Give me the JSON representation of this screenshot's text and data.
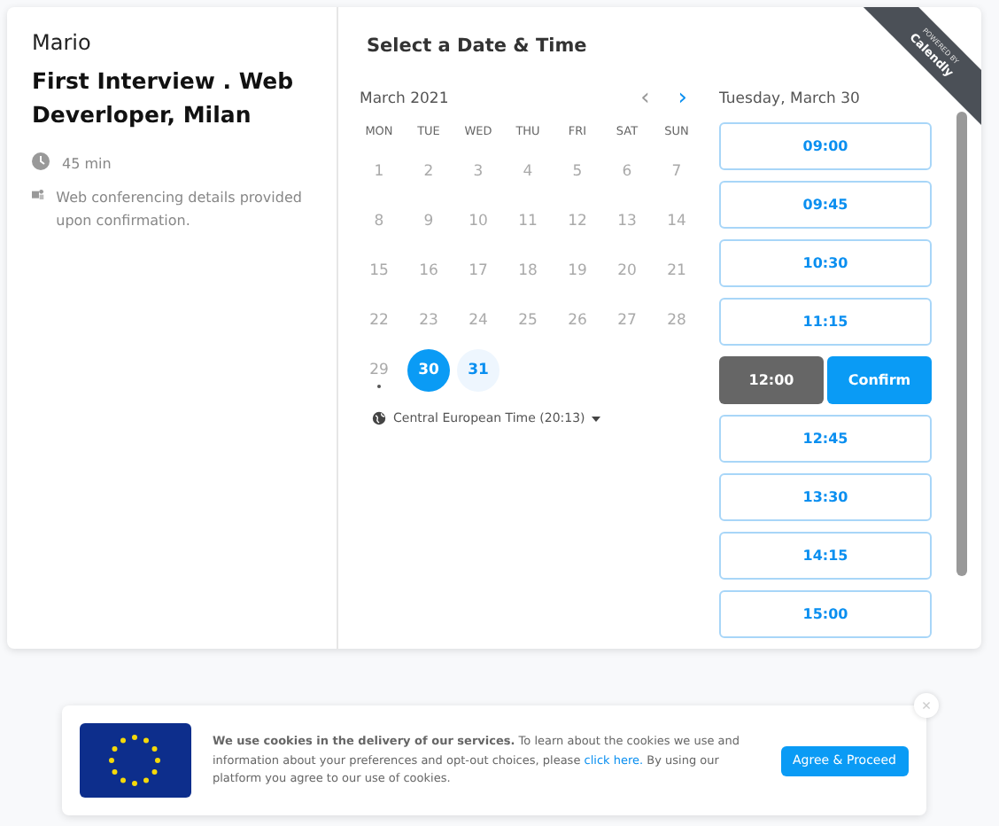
{
  "host": {
    "name": "Mario"
  },
  "event": {
    "title": "First Interview . Web Deverloper, Milan",
    "details": [
      {
        "kind": "duration",
        "text": "45 min"
      },
      {
        "kind": "conferencing",
        "text": "Web conferencing details provided upon confirmation."
      }
    ]
  },
  "badge": {
    "top": "POWERED BY",
    "brand": "Calendly"
  },
  "scheduler": {
    "title": "Select a Date & Time",
    "month": "March 2021",
    "prev": "‹",
    "next": "›",
    "weekdays": [
      "MON",
      "TUE",
      "WED",
      "THU",
      "FRI",
      "SAT",
      "SUN"
    ],
    "days": [
      {
        "label": "1",
        "available": false,
        "selected": false,
        "today": false
      },
      {
        "label": "2",
        "available": false,
        "selected": false,
        "today": false
      },
      {
        "label": "3",
        "available": false,
        "selected": false,
        "today": false
      },
      {
        "label": "4",
        "available": false,
        "selected": false,
        "today": false
      },
      {
        "label": "5",
        "available": false,
        "selected": false,
        "today": false
      },
      {
        "label": "6",
        "available": false,
        "selected": false,
        "today": false
      },
      {
        "label": "7",
        "available": false,
        "selected": false,
        "today": false
      },
      {
        "label": "8",
        "available": false,
        "selected": false,
        "today": false
      },
      {
        "label": "9",
        "available": false,
        "selected": false,
        "today": false
      },
      {
        "label": "10",
        "available": false,
        "selected": false,
        "today": false
      },
      {
        "label": "11",
        "available": false,
        "selected": false,
        "today": false
      },
      {
        "label": "12",
        "available": false,
        "selected": false,
        "today": false
      },
      {
        "label": "13",
        "available": false,
        "selected": false,
        "today": false
      },
      {
        "label": "14",
        "available": false,
        "selected": false,
        "today": false
      },
      {
        "label": "15",
        "available": false,
        "selected": false,
        "today": false
      },
      {
        "label": "16",
        "available": false,
        "selected": false,
        "today": false
      },
      {
        "label": "17",
        "available": false,
        "selected": false,
        "today": false
      },
      {
        "label": "18",
        "available": false,
        "selected": false,
        "today": false
      },
      {
        "label": "19",
        "available": false,
        "selected": false,
        "today": false
      },
      {
        "label": "20",
        "available": false,
        "selected": false,
        "today": false
      },
      {
        "label": "21",
        "available": false,
        "selected": false,
        "today": false
      },
      {
        "label": "22",
        "available": false,
        "selected": false,
        "today": false
      },
      {
        "label": "23",
        "available": false,
        "selected": false,
        "today": false
      },
      {
        "label": "24",
        "available": false,
        "selected": false,
        "today": false
      },
      {
        "label": "25",
        "available": false,
        "selected": false,
        "today": false
      },
      {
        "label": "26",
        "available": false,
        "selected": false,
        "today": false
      },
      {
        "label": "27",
        "available": false,
        "selected": false,
        "today": false
      },
      {
        "label": "28",
        "available": false,
        "selected": false,
        "today": false
      },
      {
        "label": "29",
        "available": false,
        "selected": false,
        "today": true
      },
      {
        "label": "30",
        "available": true,
        "selected": true,
        "today": false
      },
      {
        "label": "31",
        "available": true,
        "selected": false,
        "today": false
      }
    ],
    "timezone": "Central European Time (20:13)",
    "date_heading": "Tuesday, March 30",
    "slots": [
      {
        "time": "09:00",
        "selected": false
      },
      {
        "time": "09:45",
        "selected": false
      },
      {
        "time": "10:30",
        "selected": false
      },
      {
        "time": "11:15",
        "selected": false
      },
      {
        "time": "12:00",
        "selected": true
      },
      {
        "time": "12:45",
        "selected": false
      },
      {
        "time": "13:30",
        "selected": false
      },
      {
        "time": "14:15",
        "selected": false
      },
      {
        "time": "15:00",
        "selected": false
      }
    ],
    "confirm": "Confirm"
  },
  "cookie_banner": {
    "text": "**We use cookies in the delivery of our services.** To learn about the cookies we use and information about your preferences and opt-out choices, please",
    "link": "click here.",
    "text_after": "By using our platform you agree to our use of cookies.",
    "button": "Agree & Proceed",
    "close": "×"
  }
}
